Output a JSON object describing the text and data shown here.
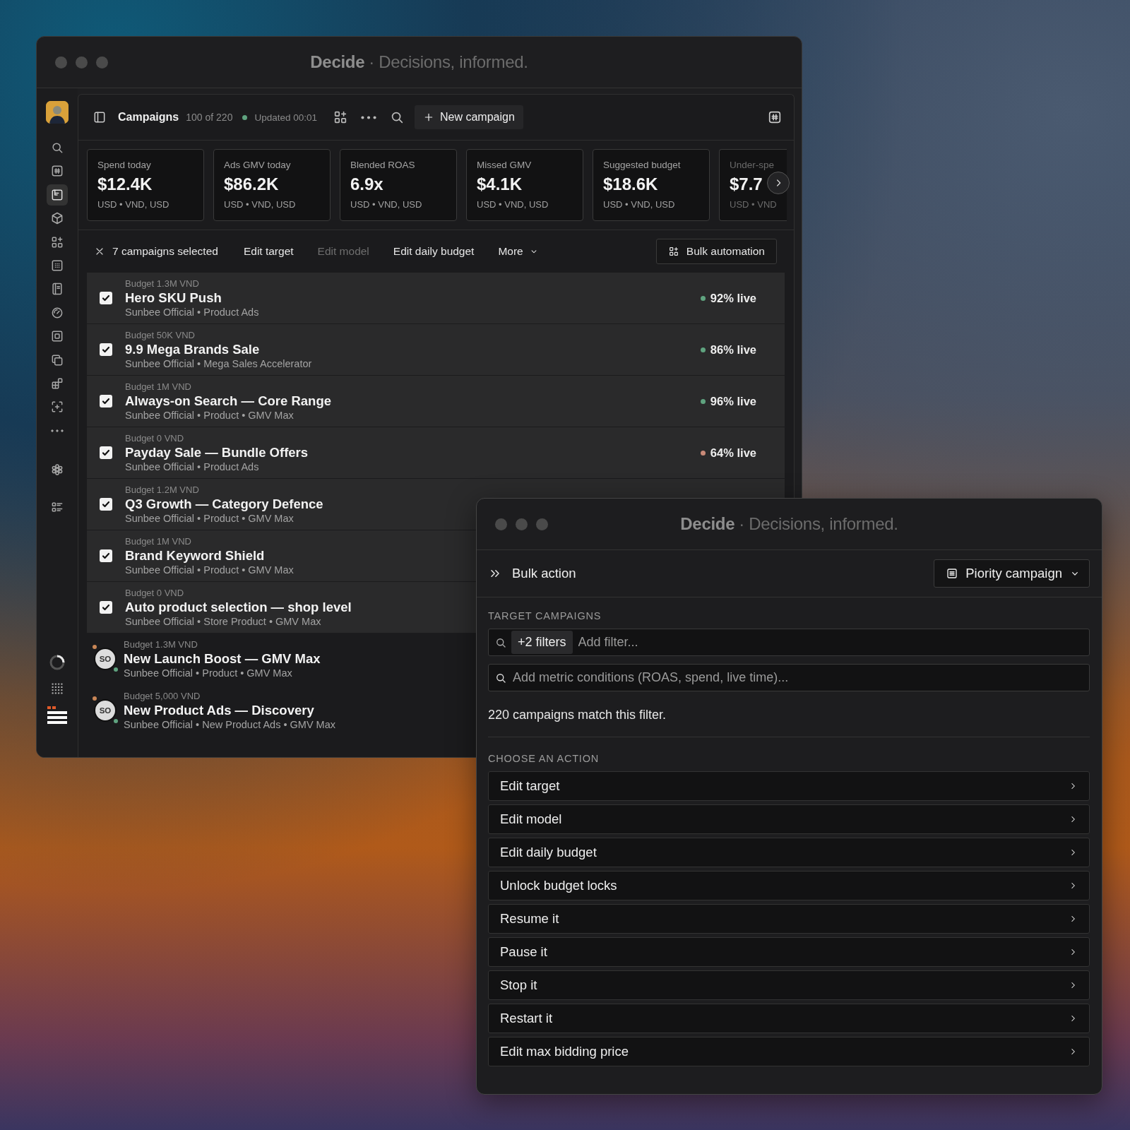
{
  "main_window": {
    "title": {
      "app": "Decide",
      "tagline": "· Decisions, informed."
    },
    "sidebar": {
      "items": [
        {
          "selected": false
        },
        {
          "selected": false
        },
        {
          "selected": true
        },
        {
          "selected": false
        },
        {
          "selected": false
        },
        {
          "selected": false
        },
        {
          "selected": false
        },
        {
          "selected": false
        },
        {
          "selected": false
        },
        {
          "selected": false
        },
        {
          "selected": false
        },
        {
          "selected": false
        },
        {
          "selected": false
        },
        {
          "selected": false
        },
        {
          "selected": false
        }
      ]
    },
    "toolbar": {
      "title": "Campaigns",
      "count": "100 of 220",
      "updated": "Updated 00:01",
      "new_button": "New campaign"
    },
    "kpis": [
      {
        "label": "Spend today",
        "value": "$12.4K",
        "note": "USD • VND, USD"
      },
      {
        "label": "Ads GMV today",
        "value": "$86.2K",
        "note": "USD • VND, USD"
      },
      {
        "label": "Blended ROAS",
        "value": "6.9x",
        "note": "USD • VND, USD"
      },
      {
        "label": "Missed GMV",
        "value": "$4.1K",
        "note": "USD • VND, USD"
      },
      {
        "label": "Suggested budget",
        "value": "$18.6K",
        "note": "USD • VND, USD"
      },
      {
        "label": "Under-spe",
        "value": "$7.7",
        "note": "USD • VND"
      }
    ],
    "selection_bar": {
      "count_text": "7 campaigns selected",
      "actions": [
        {
          "label": "Edit target",
          "kind": "link",
          "disabled": false
        },
        {
          "label": "Edit model",
          "kind": "link",
          "disabled": true
        },
        {
          "label": "Edit daily budget",
          "kind": "link",
          "disabled": false
        },
        {
          "label": "More",
          "kind": "menu",
          "disabled": false
        }
      ],
      "bulk_button": "Bulk automation"
    },
    "rows": [
      {
        "budget": "Budget 1.3M VND",
        "name": "Hero SKU Push",
        "meta": "Sunbee Official • Product Ads",
        "selected": true,
        "live": "92% live",
        "color": "#5fa37f"
      },
      {
        "budget": "Budget 50K VND",
        "name": "9.9 Mega Brands Sale",
        "meta": "Sunbee Official • Mega Sales Accelerator",
        "selected": true,
        "live": "86% live",
        "color": "#5fa37f"
      },
      {
        "budget": "Budget 1M VND",
        "name": "Always-on Search — Core Range",
        "meta": "Sunbee Official • Product • GMV Max",
        "selected": true,
        "live": "96% live",
        "color": "#5fa37f"
      },
      {
        "budget": "Budget 0 VND",
        "name": "Payday Sale — Bundle Offers",
        "meta": "Sunbee Official • Product Ads",
        "selected": true,
        "live": "64% live",
        "color": "#c98a78"
      },
      {
        "budget": "Budget 1.2M VND",
        "name": "Q3 Growth — Category Defence",
        "meta": "Sunbee Official • Product • GMV Max",
        "selected": true
      },
      {
        "budget": "Budget 1M VND",
        "name": "Brand Keyword Shield",
        "meta": "Sunbee Official • Product • GMV Max",
        "selected": true
      },
      {
        "budget": "Budget 0 VND",
        "name": "Auto product selection — shop level",
        "meta": "Sunbee Official • Store Product • GMV Max",
        "selected": true
      },
      {
        "budget": "Budget 1.3M VND",
        "name": "New Launch Boost — GMV Max",
        "meta": "Sunbee Official • Product • GMV Max",
        "selected": false,
        "avatar": "SO"
      },
      {
        "budget": "Budget 5,000 VND",
        "name": "New Product Ads — Discovery",
        "meta": "Sunbee Official • New Product Ads • GMV Max",
        "selected": false,
        "avatar": "SO"
      }
    ]
  },
  "bulk_window": {
    "title": {
      "app": "Decide",
      "tagline": "· Decisions, informed."
    },
    "header": {
      "title": "Bulk action",
      "dropdown": "Piority campaign"
    },
    "target_label": "TARGET CAMPAIGNS",
    "filter": {
      "chip": "+2 filters",
      "placeholder": "Add filter..."
    },
    "metric": {
      "placeholder": "Add metric conditions (ROAS, spend, live time)..."
    },
    "match_text": "220 campaigns match this filter.",
    "action_label": "CHOOSE AN ACTION",
    "actions": [
      "Edit target",
      "Edit model",
      "Edit daily budget",
      "Unlock budget locks",
      "Resume it",
      "Pause it",
      "Stop it",
      "Restart it",
      "Edit max bidding price"
    ]
  }
}
